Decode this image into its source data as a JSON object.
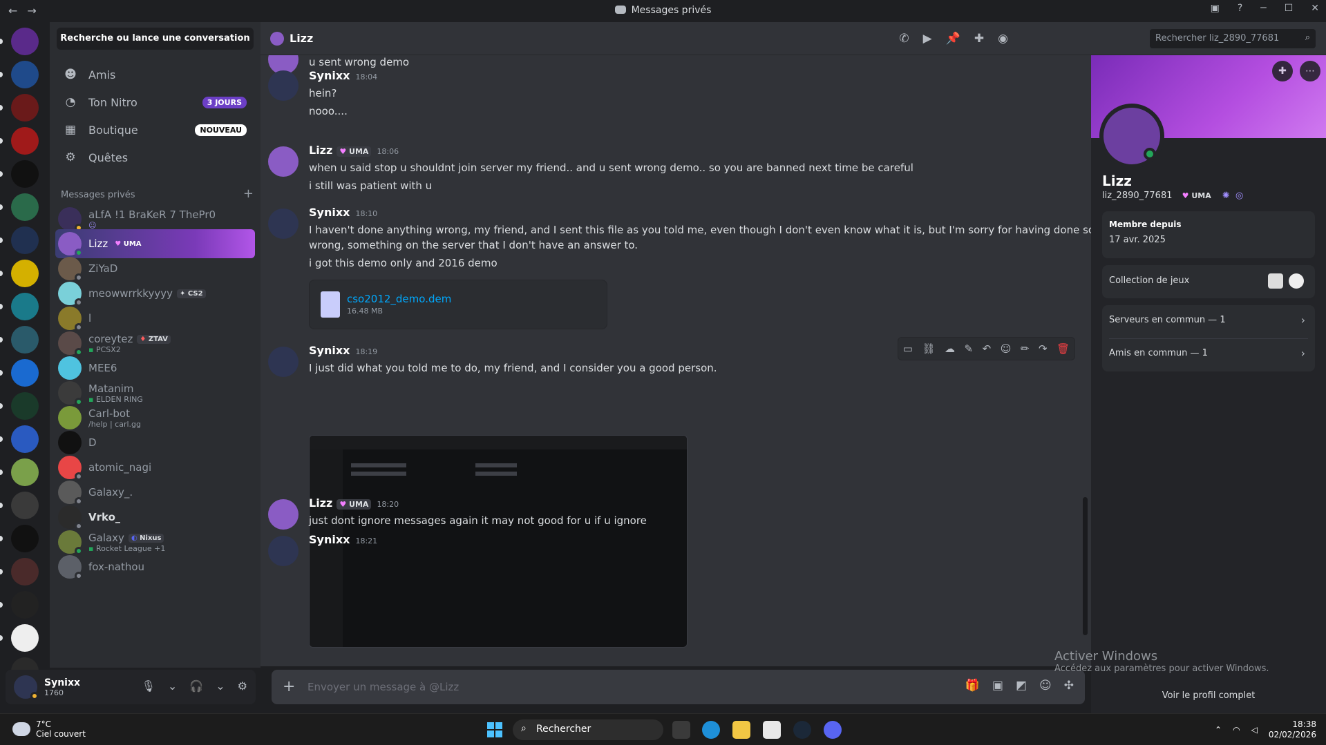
{
  "window": {
    "title": "Messages privés"
  },
  "sidebar": {
    "search_label": "Recherche ou lance une conversation",
    "nav": [
      {
        "label": "Amis",
        "icon": "friends-icon"
      },
      {
        "label": "Ton Nitro",
        "icon": "nitro-icon",
        "badge": "3 JOURS"
      },
      {
        "label": "Boutique",
        "icon": "shop-icon",
        "badge": "NOUVEAU"
      },
      {
        "label": "Quêtes",
        "icon": "quests-icon"
      }
    ],
    "dm_header": "Messages privés",
    "dms": [
      {
        "name": "aLfA !1 BraKeR 7 ThePr0",
        "sub": "",
        "color": "#3a2f5a"
      },
      {
        "name": "Lizz",
        "tag": "UMA",
        "sub": "",
        "color": "#8a5cc4",
        "selected": true
      },
      {
        "name": "ZiYaD",
        "sub": "",
        "color": "#6b5a4a"
      },
      {
        "name": "meowwrrkkyyyy",
        "tag": "CS2",
        "sub": "",
        "color": "#7ad0d9"
      },
      {
        "name": "l",
        "sub": "",
        "color": "#8a7a2a"
      },
      {
        "name": "coreytez",
        "tag": "ZTAV",
        "sub": "PCSX2",
        "color": "#5a4a48"
      },
      {
        "name": "MEE6",
        "sub": "",
        "color": "#4fc3e0"
      },
      {
        "name": "Matanim",
        "sub": "ELDEN RING",
        "color": "#3b3b3b"
      },
      {
        "name": "Carl-bot",
        "sub": "/help | carl.gg",
        "color": "#7a9a3a"
      },
      {
        "name": "D",
        "sub": "",
        "color": "#111111"
      },
      {
        "name": "atomic_nagi",
        "sub": "",
        "color": "#e84646"
      },
      {
        "name": "Galaxy_.",
        "sub": "",
        "color": "#5a5a5a"
      },
      {
        "name": "Vrko_",
        "sub": "",
        "color": "#2b2b2b"
      },
      {
        "name": "Galaxy",
        "tag": "Nixus",
        "sub": "Rocket League +1",
        "color": "#6a7a3a"
      },
      {
        "name": "fox-nathou",
        "sub": "",
        "color": "#5c6068"
      }
    ]
  },
  "user": {
    "name": "Synixx",
    "sub": "1760"
  },
  "channel": {
    "name": "Lizz",
    "search_placeholder": "Rechercher liz_2890_77681"
  },
  "messages": {
    "m0_text": "u sent wrong demo",
    "m1": {
      "author": "Synixx",
      "time": "18:04",
      "lines": [
        "hein?",
        "nooo...."
      ]
    },
    "m2": {
      "author": "Lizz",
      "tag": "UMA",
      "time": "18:06",
      "lines": [
        "when u said stop u shouldnt join server my friend.. and u sent wrong demo.. so you are banned next time be careful",
        "i still was patient with u"
      ]
    },
    "m3": {
      "author": "Synixx",
      "time": "18:10",
      "lines": [
        "I haven't done anything wrong, my friend, and I sent this file as you told me, even though I don't even know what it is, but I'm sorry for having done something",
        "wrong, something on the server that I don't have an answer to.",
        "i got this demo only and 2016 demo"
      ]
    },
    "attachment": {
      "name": "cso2012_demo.dem",
      "size": "16.48 MB"
    },
    "m4": {
      "author": "Synixx",
      "time": "18:19",
      "lines": [
        "I just did what you told me to do, my friend, and I consider you a good person."
      ]
    },
    "m5": {
      "author": "Lizz",
      "tag": "UMA",
      "time": "18:20",
      "lines": [
        "just dont ignore messages again it may not good for u if u ignore"
      ]
    },
    "m6": {
      "author": "Synixx",
      "time": "18:21"
    }
  },
  "composer": {
    "placeholder": "Envoyer un message à @Lizz"
  },
  "profile": {
    "name": "Lizz",
    "username": "liz_2890_77681",
    "tag": "UMA",
    "member_since_label": "Membre depuis",
    "member_since": "17 avr. 2025",
    "games_label": "Collection de jeux",
    "servers_common": "Serveurs en commun — 1",
    "friends_common": "Amis en commun — 1",
    "full_profile": "Voir le profil complet"
  },
  "windows_activation": {
    "title": "Activer Windows",
    "sub": "Accédez aux paramètres pour activer Windows."
  },
  "taskbar": {
    "temp": "7°C",
    "weather": "Ciel couvert",
    "search": "Rechercher",
    "time": "18:38",
    "date": "02/02/2026"
  },
  "colors": {
    "accent": "#5865f2",
    "online": "#23a55a",
    "idle": "#f0b232",
    "link": "#00a8fc",
    "danger": "#f23f43"
  }
}
